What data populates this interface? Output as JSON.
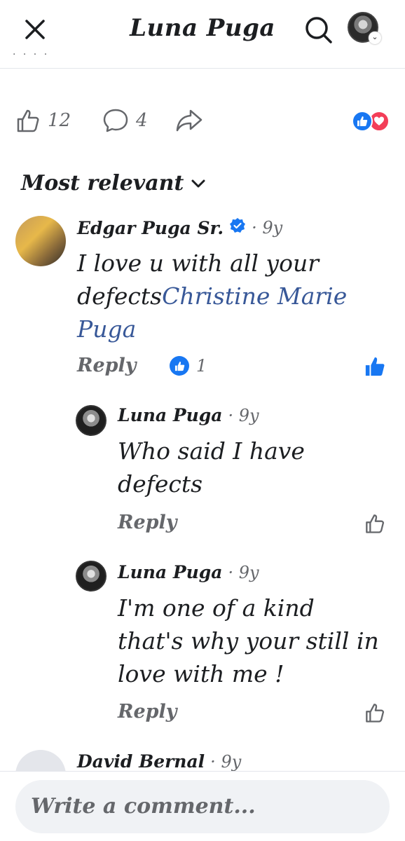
{
  "header": {
    "title": "Luna Puga",
    "more_dots": "· · · ·"
  },
  "post_actions": {
    "like_count": "12",
    "comment_count": "4"
  },
  "sort": {
    "label": "Most relevant"
  },
  "comments": [
    {
      "name": "Edgar Puga Sr.",
      "time": "9y",
      "text_line1": "I love u with all your",
      "text_line2_prefix": "defects",
      "mention": "Christine Marie",
      "mention_line2": "Puga",
      "reply": "Reply",
      "reaction_count": "1"
    },
    {
      "name": "Luna Puga",
      "time": "9y",
      "text_line1": "Who said I have",
      "text_line2": "defects",
      "reply": "Reply"
    },
    {
      "name": "Luna Puga",
      "time": "9y",
      "text_line1": "I'm one of a kind",
      "text_line2": "that's why your still in",
      "text_line3": "love with me !",
      "reply": "Reply"
    },
    {
      "name": "David Bernal",
      "time": "9y"
    }
  ],
  "composer": {
    "placeholder": "Write a comment..."
  },
  "colors": {
    "accent": "#1877f2",
    "love": "#f33e58",
    "secondary_text": "#65676b"
  }
}
